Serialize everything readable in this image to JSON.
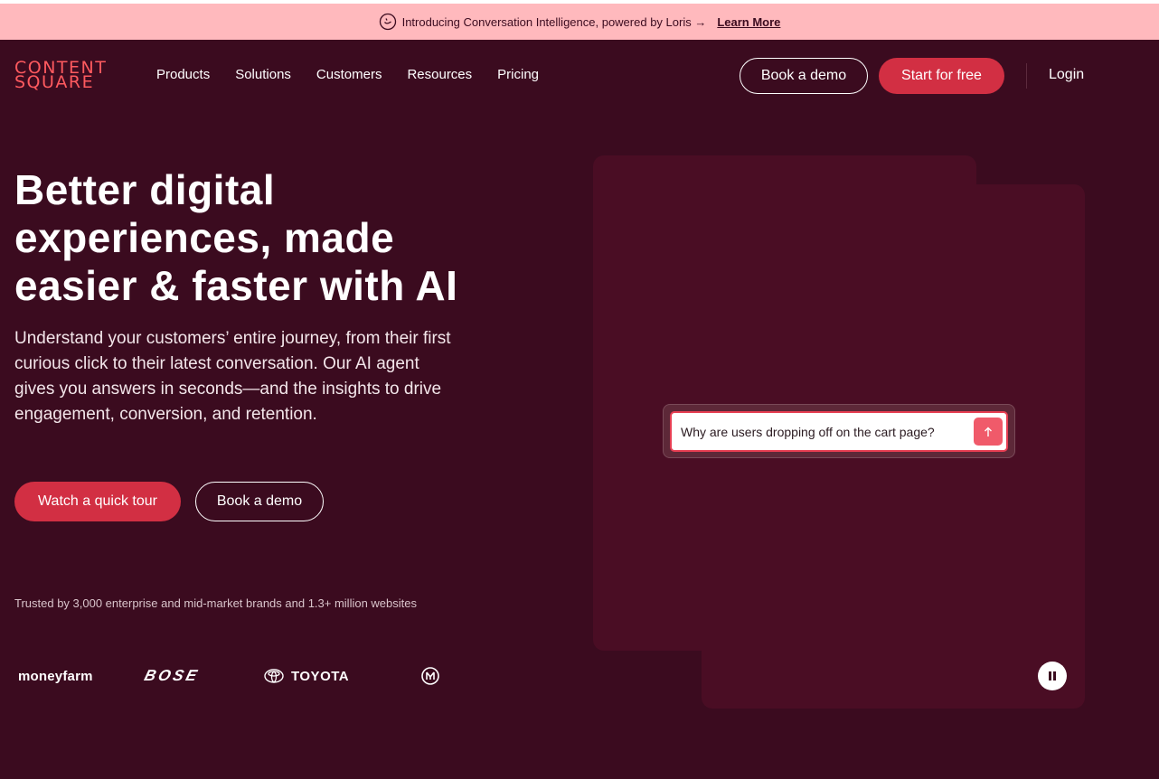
{
  "announcement": {
    "text": "Introducing Conversation Intelligence, powered by Loris →",
    "link": "Learn More"
  },
  "header": {
    "logo_line1": "CONTENT",
    "logo_line2": "SQUARE",
    "nav": [
      "Products",
      "Solutions",
      "Customers",
      "Resources",
      "Pricing"
    ],
    "book_demo": "Book a demo",
    "start_free": "Start for free",
    "login": "Login"
  },
  "hero": {
    "title": "Better digital experiences, made easier & faster with AI",
    "subtitle": "Understand your customers’ entire journey, from their first curious click to their latest conversation. Our AI agent gives you answers in seconds—and the insights to drive engagement, conversion, and retention.",
    "cta_tour": "Watch a quick tour",
    "cta_demo": "Book a demo",
    "trusted": "Trusted by 3,000 enterprise and mid-market brands and 1.3+ million websites",
    "logos": [
      "moneyfarm",
      "BOSE",
      "TOYOTA",
      "Inter"
    ]
  },
  "visual": {
    "prompt": "Why are users dropping off on the cart page?"
  },
  "colors": {
    "background": "#3b0b1f",
    "announcement": "#ffb9bd",
    "accent": "#d22f43",
    "logo": "#ff5a5f",
    "panel": "#4a0d24"
  },
  "icons": [
    "ai-spark-icon",
    "send-arrow-icon",
    "pause-icon",
    "toyota-emblem-icon",
    "inter-emblem-icon"
  ]
}
